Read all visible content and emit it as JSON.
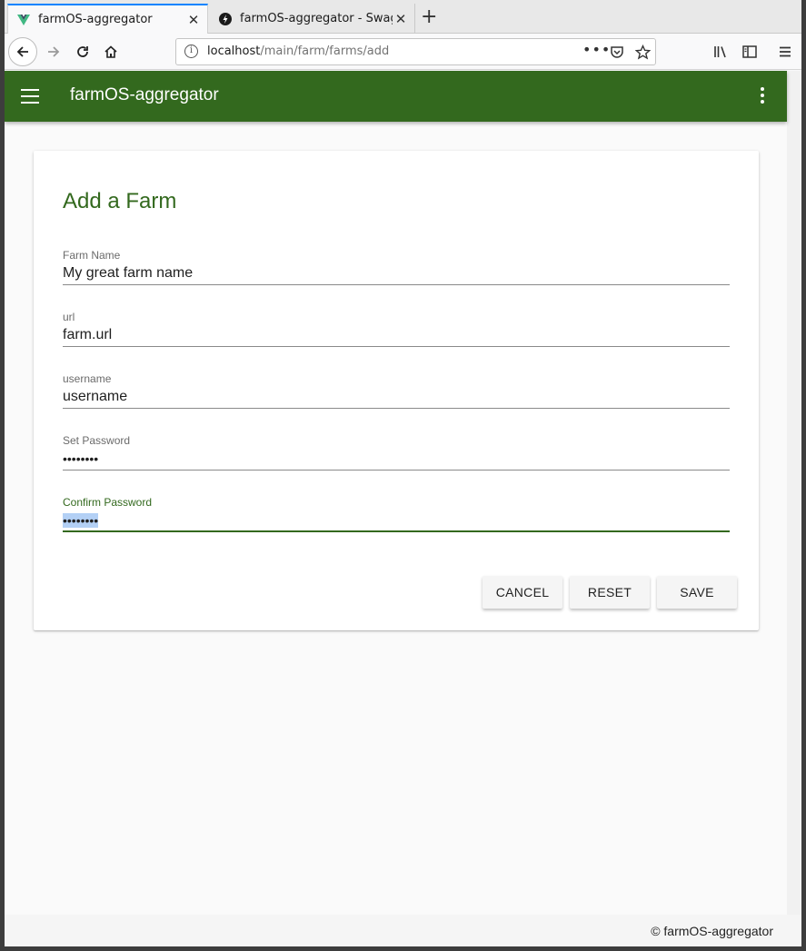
{
  "browser": {
    "tabs": [
      {
        "title": "farmOS-aggregator",
        "active": true,
        "icon": "vue-icon"
      },
      {
        "title": "farmOS-aggregator - Swag",
        "active": false,
        "icon": "swagger-icon"
      }
    ],
    "url": {
      "host": "localhost",
      "path": "/main/farm/farms/add"
    },
    "url_more": "•••"
  },
  "appbar": {
    "title": "farmOS-aggregator",
    "color": "#33691e"
  },
  "form": {
    "title": "Add a Farm",
    "fields": [
      {
        "label": "Farm Name",
        "value": "My great farm name"
      },
      {
        "label": "url",
        "value": "farm.url"
      },
      {
        "label": "username",
        "value": "username"
      },
      {
        "label": "Set Password",
        "value": "••••••••"
      },
      {
        "label": "Confirm Password",
        "value": "••••••••",
        "focused": true
      }
    ],
    "buttons": {
      "cancel": "CANCEL",
      "reset": "RESET",
      "save": "SAVE"
    }
  },
  "footer": {
    "text": "© farmOS-aggregator"
  }
}
